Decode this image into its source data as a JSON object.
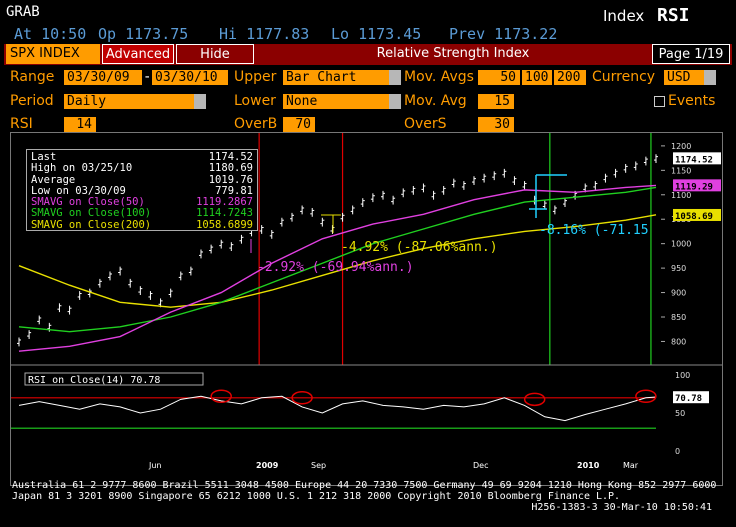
{
  "header": {
    "command": "GRAB",
    "quote": {
      "at": "At 10:50",
      "op": "Op 1173.75",
      "hi": "Hi 1177.83",
      "lo": "Lo 1173.45",
      "prev": "Prev 1173.22"
    },
    "function_prefix": "Index",
    "function_name": "RSI"
  },
  "toolbar": {
    "security": "SPX INDEX",
    "advanced": "Advanced",
    "hide": "Hide",
    "title": "Relative Strength Index",
    "page": "Page 1/19"
  },
  "settings": {
    "range_label": "Range",
    "range_start": "03/30/09",
    "range_dash": "-",
    "range_end": "03/30/10",
    "upper_label": "Upper",
    "upper_value": "Bar Chart",
    "mov_avgs_label": "Mov. Avgs",
    "mov_avgs": [
      "50",
      "100",
      "200"
    ],
    "currency_label": "Currency",
    "currency_value": "USD",
    "period_label": "Period",
    "period_value": "Daily",
    "lower_label": "Lower",
    "lower_value": "None",
    "mov_avg_label": "Mov. Avg",
    "mov_avg_value": "15",
    "events_label": "Events",
    "rsi_label": "RSI",
    "rsi_value": "14",
    "overb_label": "OverB",
    "overb_value": "70",
    "overs_label": "OverS",
    "overs_value": "30"
  },
  "legend": {
    "rows": [
      {
        "label": "Last",
        "value": "1174.52"
      },
      {
        "label": "High on 03/25/10",
        "value": "1180.69"
      },
      {
        "label": "Average",
        "value": "1019.76"
      },
      {
        "label": "Low on 03/30/09",
        "value": "779.81"
      },
      {
        "label": "SMAVG on Close(50)",
        "value": "1119.2867"
      },
      {
        "label": "SMAVG on Close(100)",
        "value": "1114.7243"
      },
      {
        "label": "SMAVG on Close(200)",
        "value": "1058.6899"
      }
    ],
    "colors": [
      "#ffffff",
      "#ffffff",
      "#ffffff",
      "#ffffff",
      "#e040e0",
      "#20d020",
      "#e8e000"
    ]
  },
  "annotations": {
    "a1": "-4.92% (-87.06%ann.)",
    "a2": "-2.92% (-69.94%ann.)",
    "a3": "-8.16% (-71.15"
  },
  "price_badges": {
    "last": "1174.52",
    "sma50": "1119.29",
    "sma200": "1058.69"
  },
  "rsi_panel": {
    "label": "RSI on Close(14)",
    "value": "70.78",
    "badge": "70.78",
    "overbought": 70,
    "oversold": 30
  },
  "chart_data": {
    "type": "bar",
    "title": "Relative Strength Index",
    "x_labels": [
      "Jun",
      "2009",
      "Sep",
      "Dec",
      "2010",
      "Mar"
    ],
    "y_ticks": [
      800,
      850,
      900,
      950,
      1000,
      1050,
      1100,
      1150,
      1200
    ],
    "ylim": [
      760,
      1210
    ],
    "rsi_ticks": [
      0,
      50,
      100
    ],
    "price_series": [
      [
        0,
        800
      ],
      [
        4,
        815
      ],
      [
        8,
        845
      ],
      [
        12,
        830
      ],
      [
        16,
        870
      ],
      [
        20,
        865
      ],
      [
        24,
        895
      ],
      [
        28,
        900
      ],
      [
        32,
        920
      ],
      [
        36,
        935
      ],
      [
        40,
        945
      ],
      [
        44,
        920
      ],
      [
        48,
        905
      ],
      [
        52,
        895
      ],
      [
        56,
        880
      ],
      [
        60,
        900
      ],
      [
        64,
        935
      ],
      [
        68,
        945
      ],
      [
        72,
        980
      ],
      [
        76,
        990
      ],
      [
        80,
        1000
      ],
      [
        84,
        995
      ],
      [
        88,
        1010
      ],
      [
        92,
        1025
      ],
      [
        96,
        1030
      ],
      [
        100,
        1020
      ],
      [
        104,
        1045
      ],
      [
        108,
        1055
      ],
      [
        112,
        1070
      ],
      [
        116,
        1065
      ],
      [
        120,
        1045
      ],
      [
        124,
        1030
      ],
      [
        128,
        1055
      ],
      [
        132,
        1070
      ],
      [
        136,
        1085
      ],
      [
        140,
        1095
      ],
      [
        144,
        1100
      ],
      [
        148,
        1090
      ],
      [
        152,
        1105
      ],
      [
        156,
        1110
      ],
      [
        160,
        1115
      ],
      [
        164,
        1100
      ],
      [
        168,
        1110
      ],
      [
        172,
        1125
      ],
      [
        176,
        1120
      ],
      [
        180,
        1130
      ],
      [
        184,
        1135
      ],
      [
        188,
        1140
      ],
      [
        192,
        1145
      ],
      [
        196,
        1130
      ],
      [
        200,
        1120
      ],
      [
        204,
        1090
      ],
      [
        208,
        1080
      ],
      [
        212,
        1070
      ],
      [
        216,
        1085
      ],
      [
        220,
        1100
      ],
      [
        224,
        1115
      ],
      [
        228,
        1120
      ],
      [
        232,
        1135
      ],
      [
        236,
        1145
      ],
      [
        240,
        1155
      ],
      [
        244,
        1160
      ],
      [
        248,
        1170
      ],
      [
        252,
        1175
      ]
    ],
    "sma50": [
      [
        0,
        780
      ],
      [
        20,
        790
      ],
      [
        40,
        810
      ],
      [
        60,
        860
      ],
      [
        80,
        900
      ],
      [
        100,
        960
      ],
      [
        120,
        1010
      ],
      [
        140,
        1040
      ],
      [
        160,
        1060
      ],
      [
        180,
        1090
      ],
      [
        200,
        1110
      ],
      [
        220,
        1105
      ],
      [
        240,
        1115
      ],
      [
        252,
        1119
      ]
    ],
    "sma100": [
      [
        0,
        830
      ],
      [
        20,
        820
      ],
      [
        40,
        830
      ],
      [
        60,
        850
      ],
      [
        80,
        880
      ],
      [
        100,
        920
      ],
      [
        120,
        960
      ],
      [
        140,
        1000
      ],
      [
        160,
        1030
      ],
      [
        180,
        1060
      ],
      [
        200,
        1085
      ],
      [
        220,
        1095
      ],
      [
        240,
        1105
      ],
      [
        252,
        1115
      ]
    ],
    "sma200": [
      [
        0,
        955
      ],
      [
        20,
        915
      ],
      [
        40,
        880
      ],
      [
        60,
        870
      ],
      [
        80,
        880
      ],
      [
        100,
        905
      ],
      [
        120,
        935
      ],
      [
        140,
        965
      ],
      [
        160,
        990
      ],
      [
        180,
        1010
      ],
      [
        200,
        1025
      ],
      [
        220,
        1035
      ],
      [
        240,
        1048
      ],
      [
        252,
        1059
      ]
    ],
    "rsi": [
      [
        0,
        60
      ],
      [
        8,
        65
      ],
      [
        16,
        60
      ],
      [
        24,
        55
      ],
      [
        32,
        62
      ],
      [
        40,
        58
      ],
      [
        48,
        50
      ],
      [
        56,
        55
      ],
      [
        64,
        68
      ],
      [
        72,
        72
      ],
      [
        80,
        66
      ],
      [
        88,
        62
      ],
      [
        96,
        70
      ],
      [
        104,
        72
      ],
      [
        112,
        58
      ],
      [
        120,
        50
      ],
      [
        128,
        62
      ],
      [
        136,
        66
      ],
      [
        144,
        60
      ],
      [
        152,
        58
      ],
      [
        160,
        55
      ],
      [
        168,
        60
      ],
      [
        176,
        58
      ],
      [
        184,
        62
      ],
      [
        192,
        70
      ],
      [
        200,
        60
      ],
      [
        208,
        45
      ],
      [
        216,
        40
      ],
      [
        224,
        48
      ],
      [
        232,
        55
      ],
      [
        240,
        62
      ],
      [
        248,
        70
      ],
      [
        252,
        71
      ]
    ]
  },
  "footer": {
    "line1": "Australia 61 2 9777 8600 Brazil 5511 3048 4500 Europe 44 20 7330 7500 Germany 49 69 9204 1210 Hong Kong 852 2977 6000",
    "line2": "Japan 81 3 3201 8900         Singapore 65 6212 1000         U.S. 1 212 318 2000           Copyright 2010 Bloomberg Finance L.P.",
    "line3": "H256-1383-3 30-Mar-10 10:50:41"
  }
}
